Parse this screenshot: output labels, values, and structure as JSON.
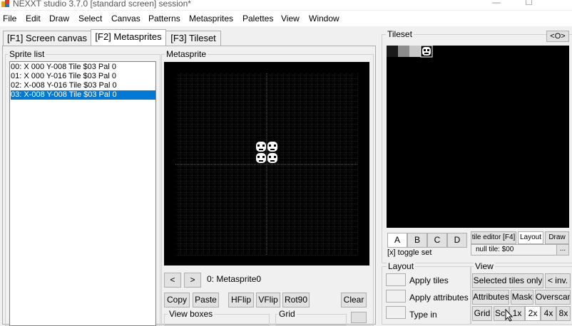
{
  "window": {
    "title": "NEXXT studio 3.7.0  [standard screen] session*",
    "controls": [
      "—",
      "☐"
    ]
  },
  "menu": [
    "File",
    "Edit",
    "Draw",
    "Select",
    "Canvas",
    "Patterns",
    "Metasprites",
    "Palettes",
    "View",
    "Window"
  ],
  "tabs": [
    {
      "label": "[F1] Screen canvas",
      "active": false
    },
    {
      "label": "[F2] Metasprites",
      "active": true
    },
    {
      "label": "[F3] Tileset",
      "active": false
    }
  ],
  "sprite_list": {
    "title": "Sprite list",
    "items": [
      "00: X 000 Y-008 Tile $03 Pal 0",
      "01: X 000 Y-016 Tile $03 Pal 0",
      "02: X-008 Y-016 Tile $03 Pal 0",
      "03: X-008 Y-008 Tile $03 Pal 0"
    ],
    "selected_index": 3
  },
  "metasprite": {
    "title": "Metasprite",
    "prev": "<",
    "next": ">",
    "name": "0: Metasprite0",
    "buttons": [
      "Copy",
      "Paste",
      "HFlip",
      "VFlip",
      "Rot90",
      "Clear"
    ],
    "view_boxes_label": "View boxes",
    "grid_label": "Grid"
  },
  "tileset": {
    "title": "Tileset",
    "toggle_button": "<O>",
    "banks": [
      "A",
      "B",
      "C",
      "D"
    ],
    "tile_editor_button": "tile editor [F4]",
    "layout_button": "Layout",
    "draw_button": "Draw",
    "toggle_set_label": "[x] toggle set",
    "null_tile_label": "null tile: $00",
    "more_button": "...",
    "tile_colors": [
      "#4a4a4a",
      "#8c8c8c",
      "#c8c8c8"
    ]
  },
  "layout_group": {
    "title": "Layout",
    "apply_tiles": "Apply tiles",
    "apply_attributes": "Apply attributes",
    "type_in": "Type in"
  },
  "view_group": {
    "title": "View",
    "selected_tiles_only": "Selected tiles only",
    "inv": "< inv.",
    "attributes": "Attributes",
    "mask": "Mask",
    "overscan": "Overscan",
    "grid": "Grid",
    "scr": "Scr",
    "zoom": [
      "1x",
      "2x",
      "4x",
      "8x"
    ],
    "active_zoom": "2x"
  }
}
